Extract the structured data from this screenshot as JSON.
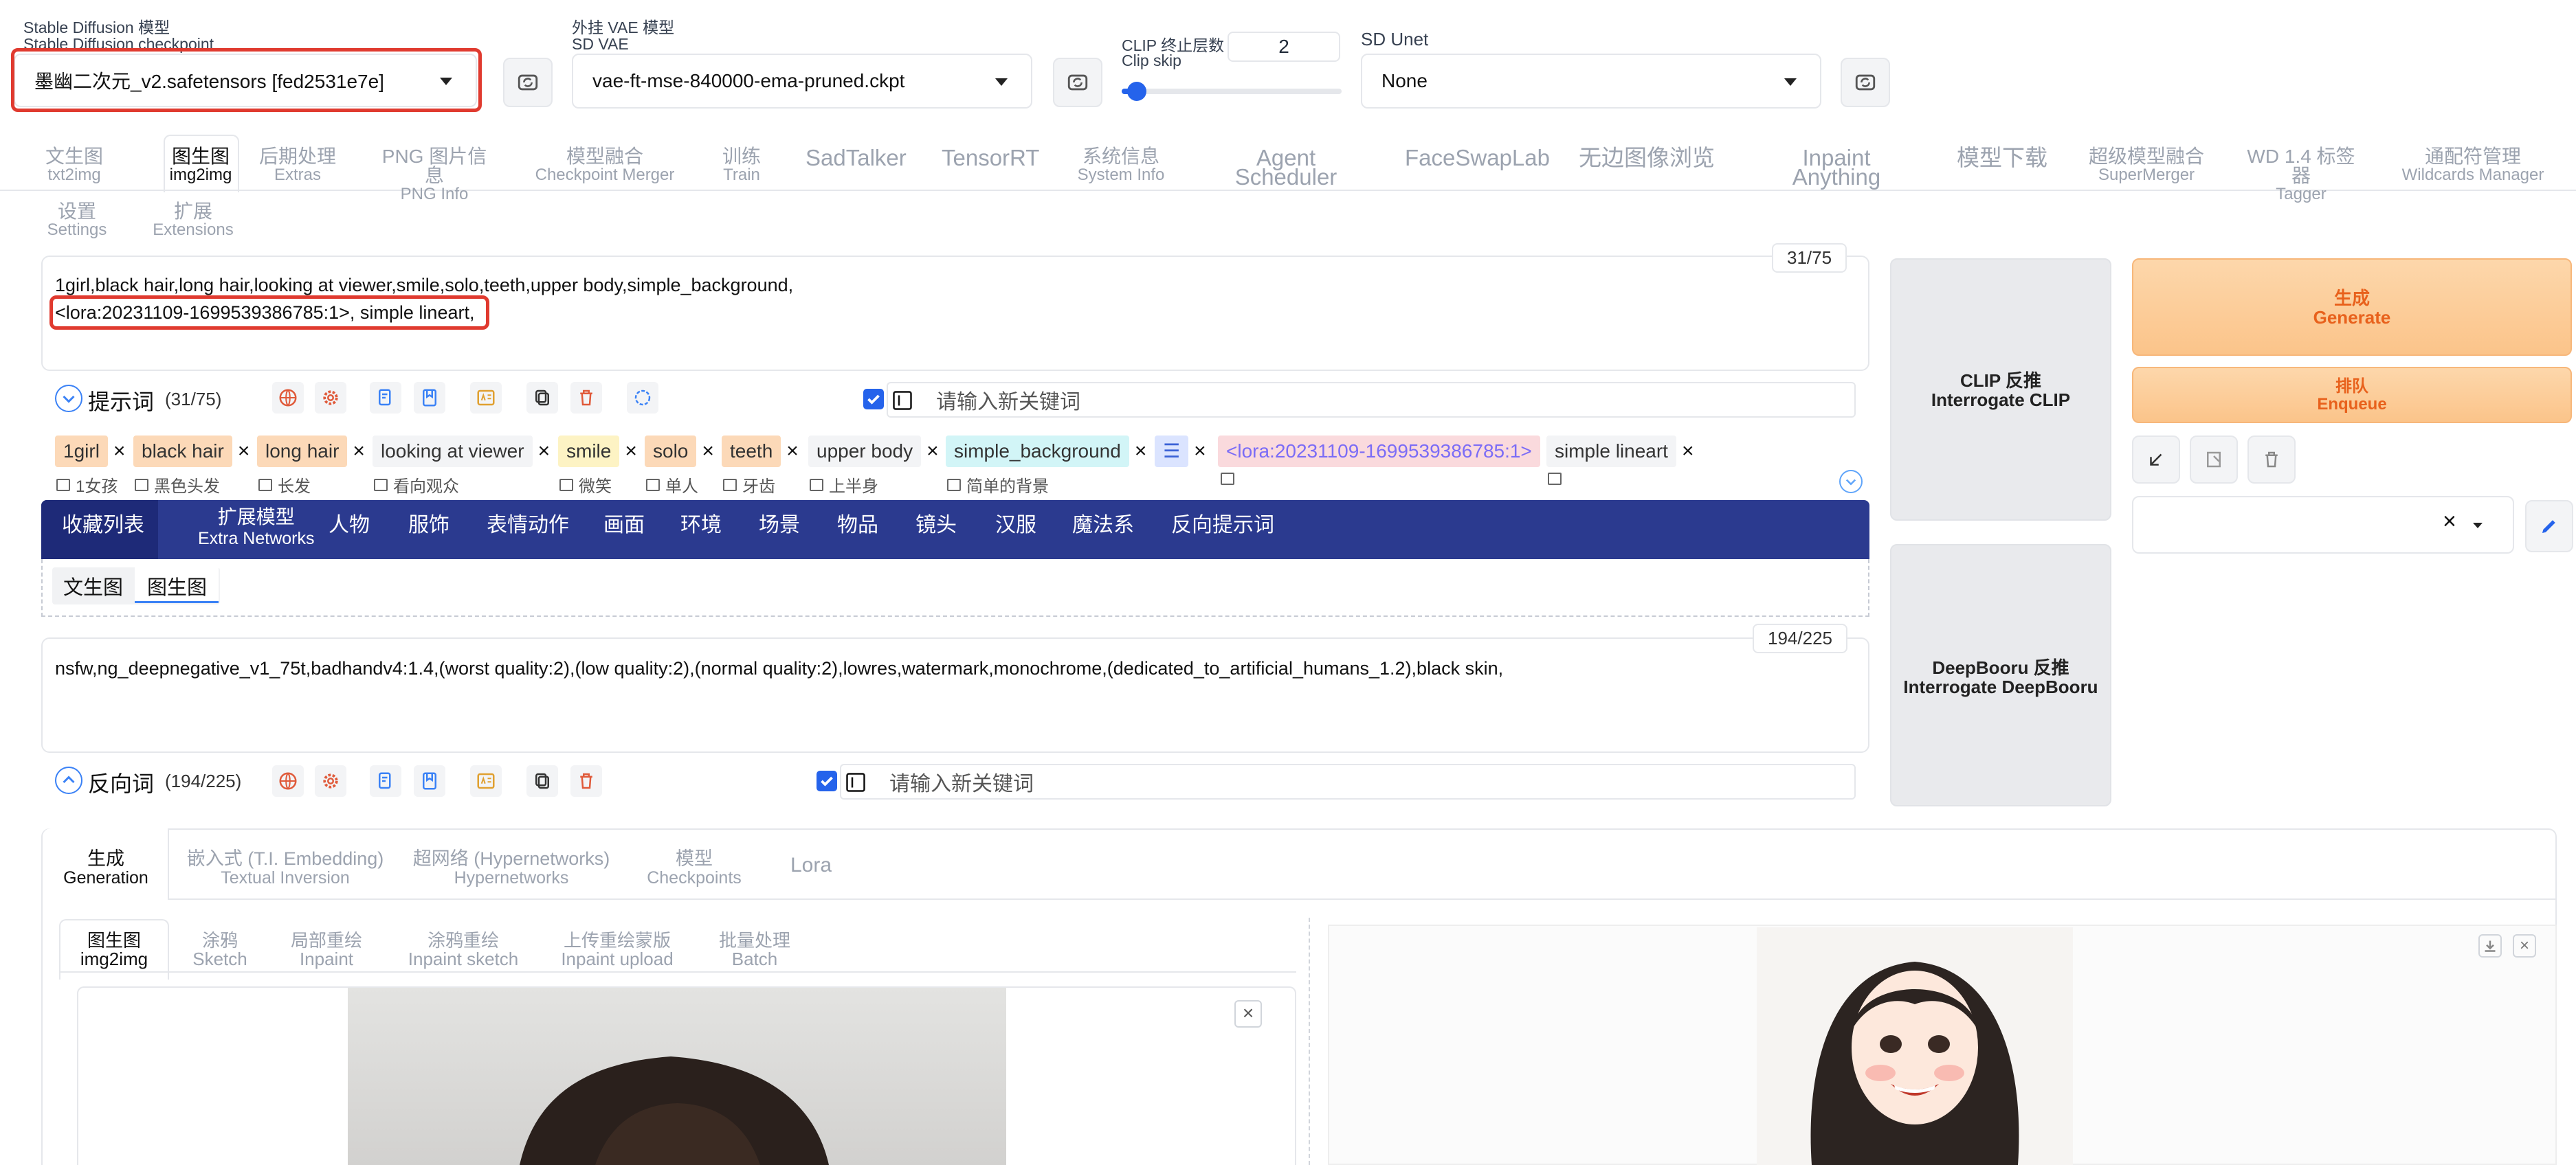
{
  "top": {
    "sd_model_label_cn": "Stable Diffusion 模型",
    "sd_model_label_en": "Stable Diffusion checkpoint",
    "sd_model_value": "墨幽二次元_v2.safetensors [fed2531e7e]",
    "vae_label_cn": "外挂 VAE 模型",
    "vae_label_en": "SD VAE",
    "vae_value": "vae-ft-mse-840000-ema-pruned.ckpt",
    "clip_label_cn": "CLIP 终止层数",
    "clip_label_en": "Clip skip",
    "clip_value": "2",
    "clip_slider_fraction": 0.07,
    "unet_label": "SD Unet",
    "unet_value": "None"
  },
  "tabs": [
    {
      "cn": "文生图",
      "en": "txt2img"
    },
    {
      "cn": "图生图",
      "en": "img2img"
    },
    {
      "cn": "后期处理",
      "en": "Extras"
    },
    {
      "cn": "PNG 图片信息",
      "en": "PNG Info"
    },
    {
      "cn": "模型融合",
      "en": "Checkpoint Merger"
    },
    {
      "cn": "训练",
      "en": "Train"
    },
    {
      "cn": "SadTalker",
      "en": ""
    },
    {
      "cn": "TensorRT",
      "en": ""
    },
    {
      "cn": "系统信息",
      "en": "System Info"
    },
    {
      "cn": "Agent Scheduler",
      "en": ""
    },
    {
      "cn": "FaceSwapLab",
      "en": ""
    },
    {
      "cn": "无边图像浏览",
      "en": ""
    },
    {
      "cn": "Inpaint Anything",
      "en": ""
    },
    {
      "cn": "模型下载",
      "en": ""
    },
    {
      "cn": "超级模型融合",
      "en": "SuperMerger"
    },
    {
      "cn": "WD 1.4 标签器",
      "en": "Tagger"
    },
    {
      "cn": "通配符管理",
      "en": "Wildcards Manager"
    },
    {
      "cn": "设置",
      "en": "Settings"
    },
    {
      "cn": "扩展",
      "en": "Extensions"
    }
  ],
  "prompt": {
    "line1": "1girl,black hair,long hair,looking at viewer,smile,solo,teeth,upper body,simple_background,",
    "line2": "<lora:20231109-1699539386785:1>, simple lineart,",
    "counter": "31/75",
    "section_label": "提示词",
    "section_count": "(31/75)",
    "keyword_placeholder": "请输入新关键词"
  },
  "tags": [
    {
      "text": "1girl",
      "tr": "1女孩"
    },
    {
      "text": "black hair",
      "tr": "黑色头发"
    },
    {
      "text": "long hair",
      "tr": "长发"
    },
    {
      "text": "looking at viewer",
      "tr": "看向观众"
    },
    {
      "text": "smile",
      "tr": "微笑"
    },
    {
      "text": "solo",
      "tr": "单人"
    },
    {
      "text": "teeth",
      "tr": "牙齿"
    },
    {
      "text": "upper body",
      "tr": "上半身"
    },
    {
      "text": "simple_background",
      "tr": "简单的背景"
    },
    {
      "text": "<lora:20231109-1699539386785:1>",
      "tr": ""
    },
    {
      "text": "simple lineart",
      "tr": ""
    }
  ],
  "categories": [
    "收藏列表",
    "扩展模型",
    "Extra Networks",
    "人物",
    "服饰",
    "表情动作",
    "画面",
    "环境",
    "场景",
    "物品",
    "镜头",
    "汉服",
    "魔法系",
    "反向提示词"
  ],
  "subtabs": [
    "文生图",
    "图生图"
  ],
  "negative": {
    "text": "nsfw,ng_deepnegative_v1_75t,badhandv4:1.4,(worst quality:2),(low quality:2),(normal quality:2),lowres,watermark,monochrome,(dedicated_to_artificial_humans_1.2),black skin,",
    "counter": "194/225",
    "section_label": "反向词",
    "section_count": "(194/225)",
    "keyword_placeholder": "请输入新关键词"
  },
  "interrogate": {
    "clip_cn": "CLIP 反推",
    "clip_en": "Interrogate CLIP",
    "db_cn": "DeepBooru 反推",
    "db_en": "Interrogate DeepBooru"
  },
  "actions": {
    "generate_cn": "生成",
    "generate_en": "Generate",
    "enqueue_cn": "排队",
    "enqueue_en": "Enqueue",
    "style_clear": "×"
  },
  "gen_tabs": [
    {
      "cn": "生成",
      "en": "Generation"
    },
    {
      "cn": "嵌入式 (T.I. Embedding)",
      "en": "Textual Inversion"
    },
    {
      "cn": "超网络 (Hypernetworks)",
      "en": "Hypernetworks"
    },
    {
      "cn": "模型",
      "en": "Checkpoints"
    },
    {
      "cn": "Lora",
      "en": ""
    }
  ],
  "img_tabs": [
    {
      "cn": "图生图",
      "en": "img2img"
    },
    {
      "cn": "涂鸦",
      "en": "Sketch"
    },
    {
      "cn": "局部重绘",
      "en": "Inpaint"
    },
    {
      "cn": "涂鸦重绘",
      "en": "Inpaint sketch"
    },
    {
      "cn": "上传重绘蒙版",
      "en": "Inpaint upload"
    },
    {
      "cn": "批量处理",
      "en": "Batch"
    }
  ],
  "colors": {
    "accent_blue": "#2b3a8f",
    "tag_orange": "#fcd9b8",
    "tag_yellow": "#fdf3c4",
    "tag_cyan": "#d2f5f7",
    "tag_pink": "#fadadd",
    "lora_text": "#7b6cf6",
    "generate_bg": "#fcd1a2",
    "red_highlight": "#e03a2f"
  }
}
